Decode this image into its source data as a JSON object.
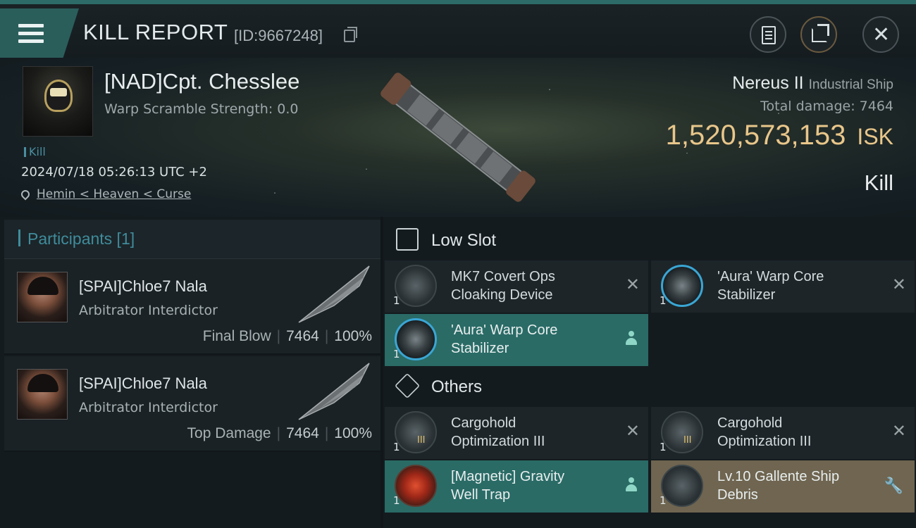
{
  "header": {
    "title": "KILL REPORT",
    "report_id": "[ID:9667248]",
    "icons": [
      "menu-icon",
      "copy-icon",
      "clipboard-icon",
      "share-icon",
      "close-icon"
    ]
  },
  "victim": {
    "name": "[NAD]Cpt. Chesslee",
    "warp_scramble": "Warp Scramble Strength: 0.0",
    "tag": "Kill",
    "datetime": "2024/07/18 05:26:13 UTC +2",
    "location": "Hemin < Heaven < Curse",
    "ship_name": "Nereus II",
    "ship_class": "Industrial Ship",
    "total_damage_label": "Total damage:",
    "total_damage": "7464",
    "isk_value": "1,520,573,153",
    "isk_unit": "ISK",
    "result": "Kill"
  },
  "participants": {
    "title": "Participants [1]",
    "rows": [
      {
        "name": "[SPAI]Chloe7 Nala",
        "ship": "Arbitrator Interdictor",
        "label": "Final Blow",
        "damage": "7464",
        "percent": "100%"
      },
      {
        "name": "[SPAI]Chloe7 Nala",
        "ship": "Arbitrator Interdictor",
        "label": "Top Damage",
        "damage": "7464",
        "percent": "100%"
      }
    ]
  },
  "low_slot": {
    "title": "Low Slot",
    "items": [
      {
        "line1": "MK7 Covert Ops",
        "line2": "Cloaking Device",
        "qty": "1",
        "status": "destroyed"
      },
      {
        "line1": "'Aura' Warp Core",
        "line2": "Stabilizer",
        "qty": "1",
        "status": "destroyed"
      },
      {
        "line1": "'Aura' Warp Core",
        "line2": "Stabilizer",
        "qty": "1",
        "status": "dropped"
      }
    ]
  },
  "others": {
    "title": "Others",
    "items": [
      {
        "line1": "Cargohold",
        "line2": "Optimization III",
        "qty": "1",
        "status": "destroyed"
      },
      {
        "line1": "Cargohold",
        "line2": "Optimization III",
        "qty": "1",
        "status": "destroyed"
      },
      {
        "line1": "[Magnetic] Gravity",
        "line2": "Well Trap",
        "qty": "1",
        "status": "dropped"
      },
      {
        "line1": "Lv.10 Gallente Ship",
        "line2": "Debris",
        "qty": "1",
        "status": "salvage"
      }
    ]
  },
  "colors": {
    "accent_teal": "#2a6b66",
    "isk_gold": "#e8c68a",
    "salvage_gold": "#6f6550"
  }
}
